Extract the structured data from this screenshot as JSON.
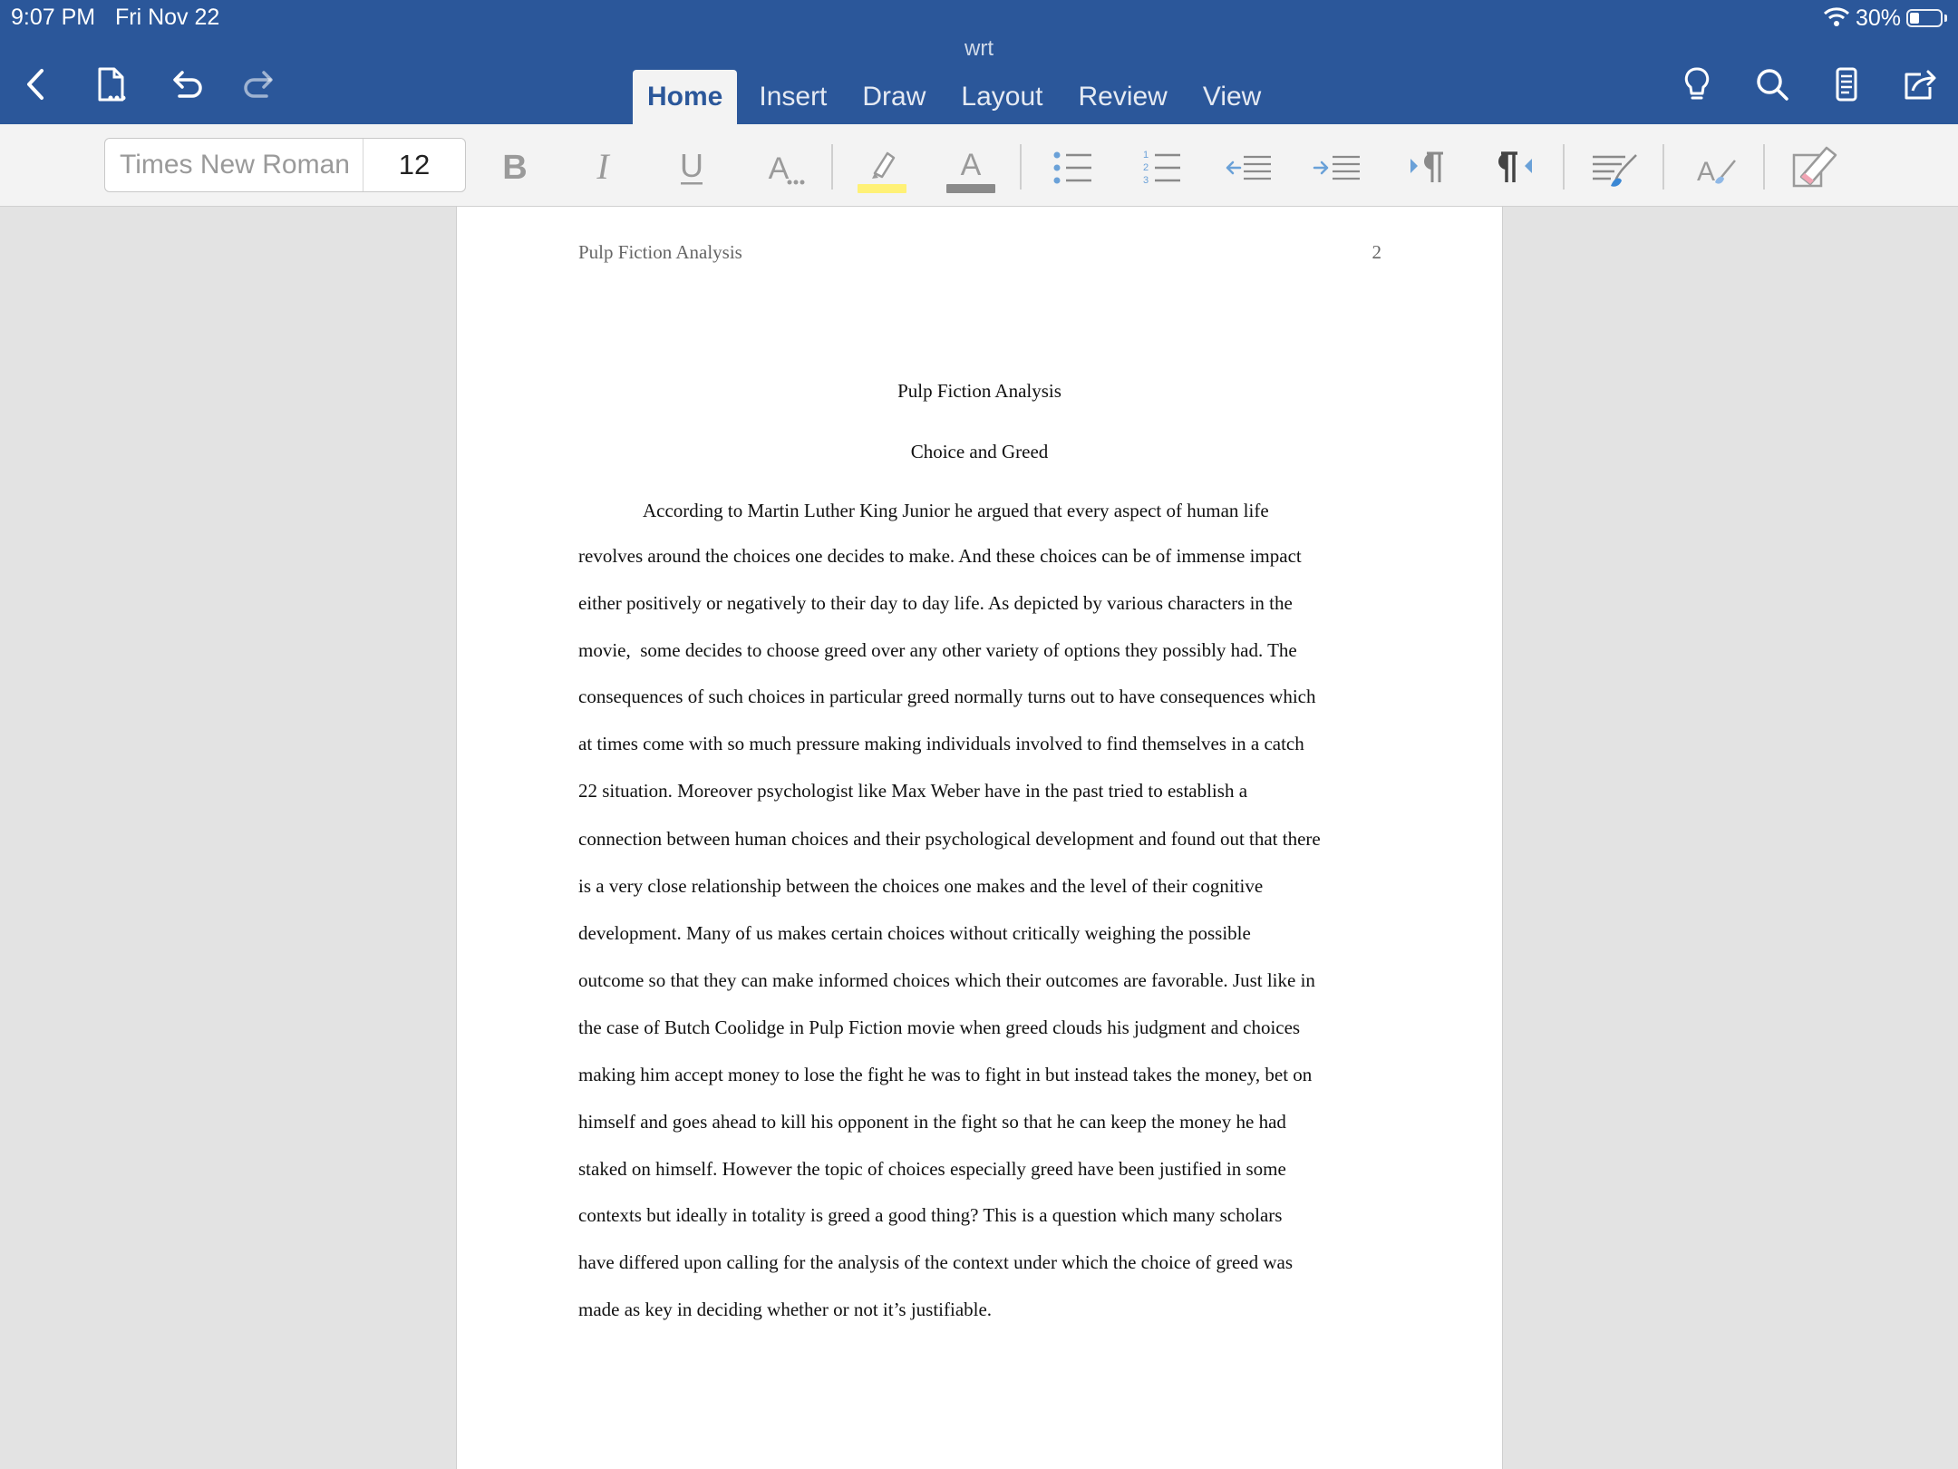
{
  "status": {
    "time": "9:07 PM",
    "date": "Fri Nov 22",
    "battery": "30%",
    "battery_level": 0.3
  },
  "document_title": "wrt",
  "tabs": [
    {
      "label": "Home",
      "active": true
    },
    {
      "label": "Insert"
    },
    {
      "label": "Draw"
    },
    {
      "label": "Layout"
    },
    {
      "label": "Review"
    },
    {
      "label": "View"
    }
  ],
  "toolbar": {
    "font_name": "Times New Roman",
    "font_size": "12",
    "highlight_color": "#fff176",
    "font_color": "#8a8a8a",
    "accent": "#2b579a"
  },
  "page": {
    "header_left": "Pulp Fiction Analysis",
    "page_number": "2",
    "title": "Pulp Fiction Analysis",
    "subtitle": "Choice and Greed",
    "lines": [
      "According to Martin Luther King Junior he argued that every aspect of human life",
      "revolves around the choices one decides to make. And these choices can be of immense impact",
      "either positively or negatively to their day to day life. As depicted by various characters in the",
      "movie,  some decides to choose greed over any other variety of options they possibly had. The",
      "consequences of such choices in particular greed normally turns out to have consequences which",
      "at times come with so much pressure making individuals involved to find themselves in a catch",
      "22 situation. Moreover psychologist like Max Weber have in the past tried to establish a",
      "connection between human choices and their psychological development and found out that there",
      "is a very close relationship between the choices one makes and the level of their cognitive",
      "development. Many of us makes certain choices without critically weighing the possible",
      "outcome so that they can make informed choices which their outcomes are favorable. Just like in",
      "the case of Butch Coolidge in Pulp Fiction movie when greed clouds his judgment and choices",
      "making him accept money to lose the fight he was to fight in but instead takes the money, bet on",
      "himself and goes ahead to kill his opponent in the fight so that he can keep the money he had",
      "staked on himself. However the topic of choices especially greed have been justified in some",
      "contexts but ideally in totality is greed a good thing? This is a question which many scholars",
      "have differed upon calling for the analysis of the context under which the choice of greed was",
      "made as key in deciding whether or not it’s justifiable."
    ]
  }
}
